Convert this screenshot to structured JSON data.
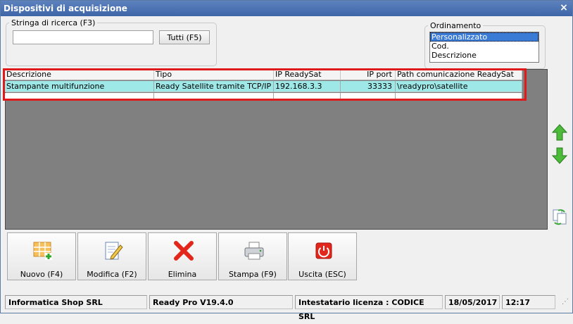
{
  "window": {
    "title": "Dispositivi di acquisizione",
    "close_glyph": "×"
  },
  "search": {
    "group_label": "Stringa di ricerca (F3)",
    "value": "",
    "placeholder": "",
    "button_label": "Tutti (F5)"
  },
  "ordering": {
    "group_label": "Ordinamento",
    "options": [
      "Personalizzato",
      "Cod.",
      "Descrizione"
    ],
    "selected": "Personalizzato"
  },
  "grid": {
    "columns": [
      "Descrizione",
      "Tipo",
      "IP ReadySat",
      "IP port",
      "Path comunicazione ReadySat"
    ],
    "rows": [
      [
        "Stampante multifunzione",
        "Ready Satellite tramite TCP/IP",
        "192.168.3.3",
        "33333",
        "\\readypro\\satellite"
      ]
    ],
    "highlight_color": "#e01a1a",
    "selected_row_color": "#9ee8e8"
  },
  "side_buttons": [
    "arrow-up-icon",
    "arrow-down-icon",
    "refresh-icon"
  ],
  "actions": [
    {
      "label": "Nuovo (F4)",
      "icon": "new-grid-icon"
    },
    {
      "label": "Modifica (F2)",
      "icon": "edit-icon"
    },
    {
      "label": "Elimina",
      "icon": "delete-x-icon"
    },
    {
      "label": "Stampa (F9)",
      "icon": "printer-icon"
    },
    {
      "label": "Uscita (ESC)",
      "icon": "exit-icon"
    }
  ],
  "status": {
    "company": "Informatica Shop SRL",
    "version": "Ready Pro V19.4.0",
    "license": "Intestatario licenza : CODICE SRL",
    "date": "18/05/2017",
    "time": "12:17"
  }
}
